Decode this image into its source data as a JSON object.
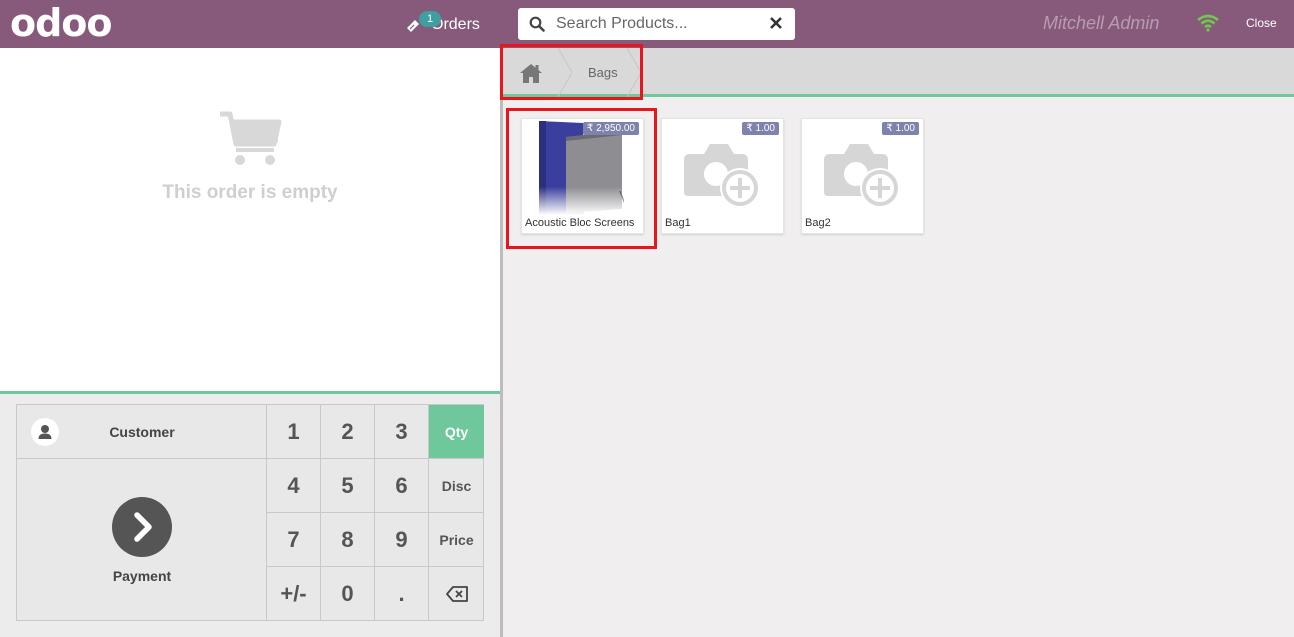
{
  "header": {
    "logo": "odoo",
    "orders_label": "Orders",
    "orders_count": "1",
    "search_placeholder": "Search Products...",
    "user_name": "Mitchell Admin",
    "close_label": "Close"
  },
  "order": {
    "empty_text": "This order is empty"
  },
  "pad": {
    "customer_label": "Customer",
    "payment_label": "Payment",
    "keys": [
      "1",
      "2",
      "3",
      "Qty",
      "4",
      "5",
      "6",
      "Disc",
      "7",
      "8",
      "9",
      "Price",
      "+/-",
      "0",
      "."
    ],
    "active_mode": "Qty"
  },
  "breadcrumb": {
    "current": "Bags"
  },
  "products": [
    {
      "name": "Acoustic Bloc Screens",
      "price": "₹ 2,950.00",
      "image": "acoustic-screen-image"
    },
    {
      "name": "Bag1",
      "price": "₹ 1.00",
      "image": "camera-placeholder-icon"
    },
    {
      "name": "Bag2",
      "price": "₹ 1.00",
      "image": "camera-placeholder-icon"
    }
  ],
  "colors": {
    "brand": "#875a7b",
    "accent": "#6ec89b",
    "price_badge": "#7f82ac",
    "highlight": "#e8161c"
  }
}
